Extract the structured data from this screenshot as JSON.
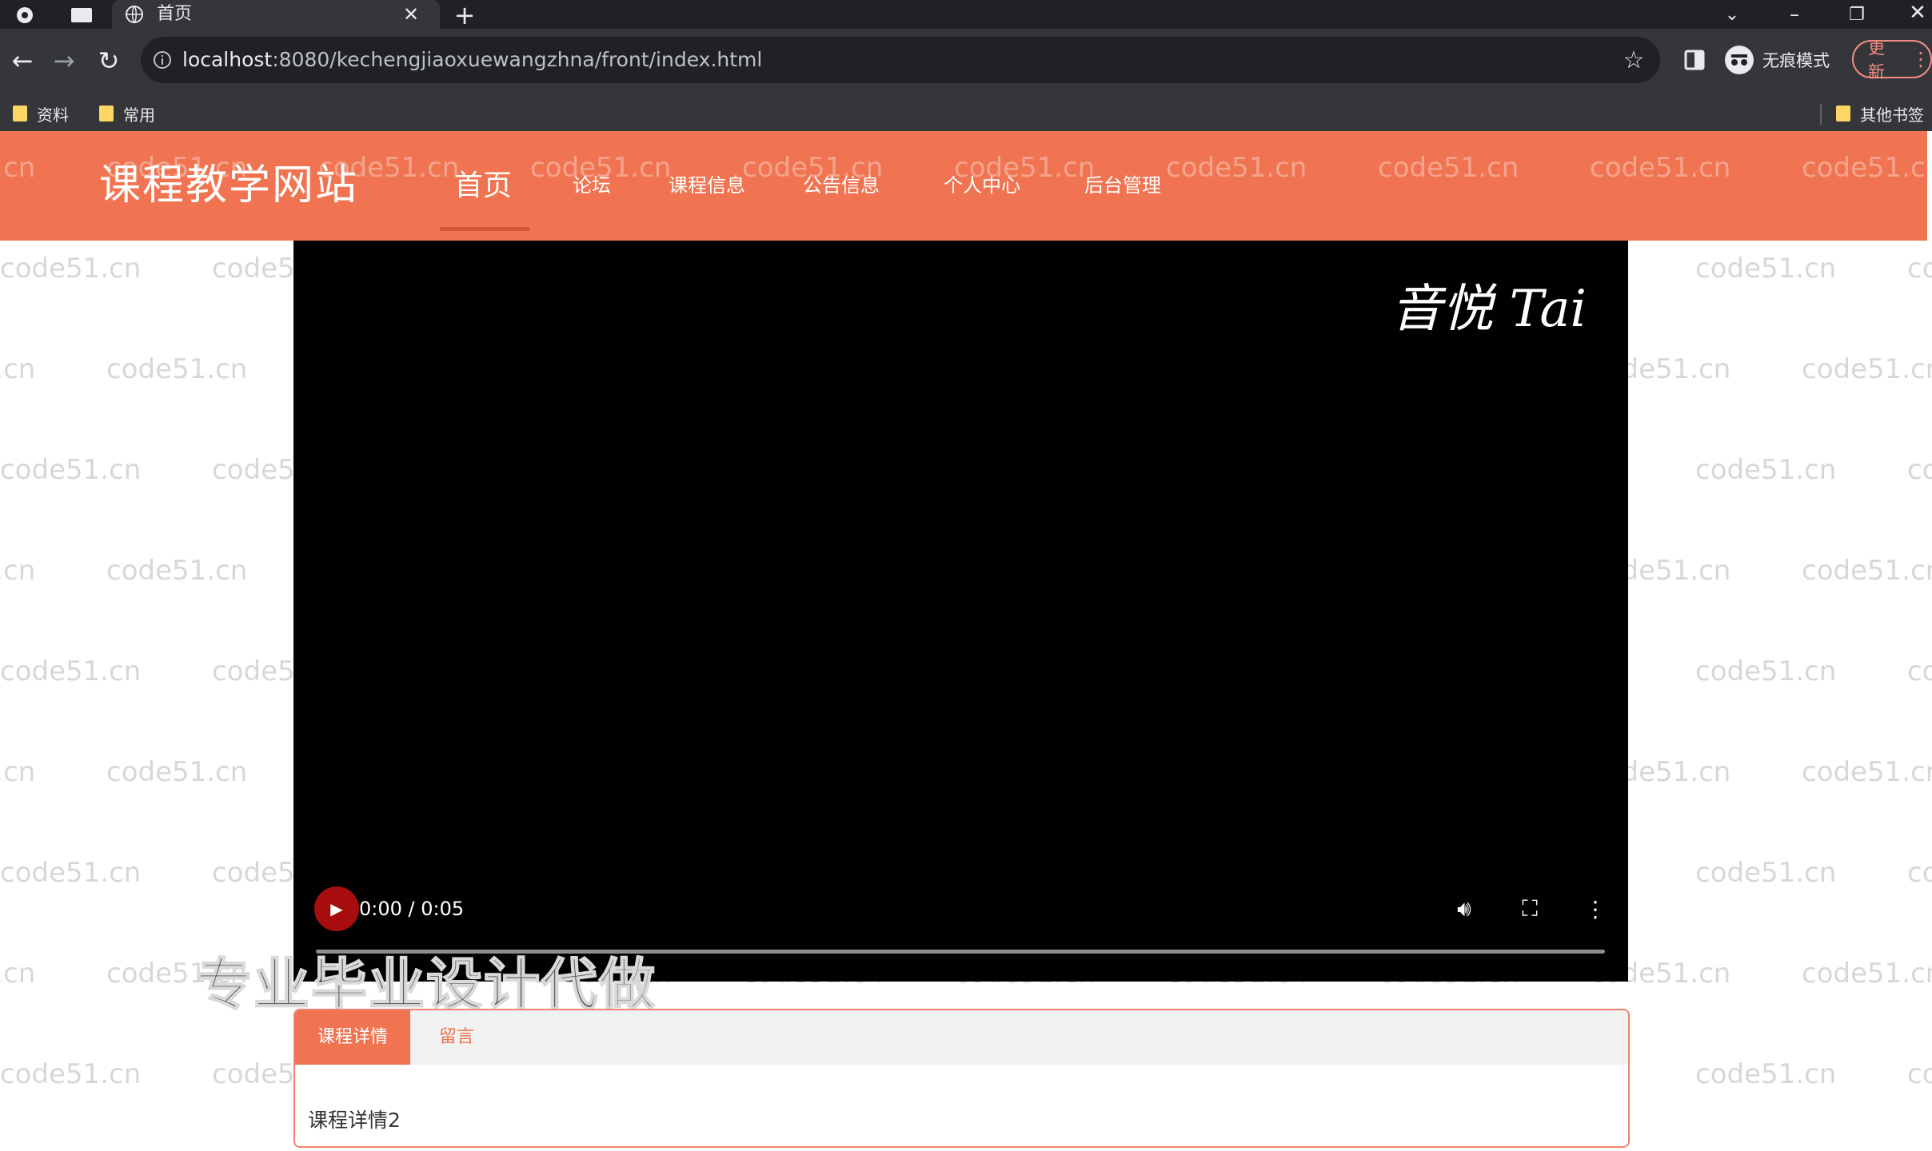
{
  "browser": {
    "tab_title": "首页",
    "url_host": "localhost",
    "url_rest": ":8080/kechengjiaoxuewangzhna/front/index.html",
    "incognito_label": "无痕模式",
    "update_label": "更新",
    "bookmarks": [
      "资料",
      "常用"
    ],
    "other_bookmarks": "其他书签"
  },
  "site": {
    "logo": "课程教学网站",
    "nav": [
      "首页",
      "论坛",
      "课程信息",
      "公告信息",
      "个人中心",
      "后台管理"
    ],
    "active_nav": "首页",
    "accent_color": "#f07451"
  },
  "video": {
    "overlay_logo": "音悦 Tai",
    "time": "0:00 / 0:05",
    "progress": 0
  },
  "overlay_caption": "专业毕业设计代做",
  "details": {
    "tabs": [
      "课程详情",
      "留言"
    ],
    "active_tab": "课程详情",
    "content": "课程详情2"
  },
  "watermark": "code51.cn"
}
